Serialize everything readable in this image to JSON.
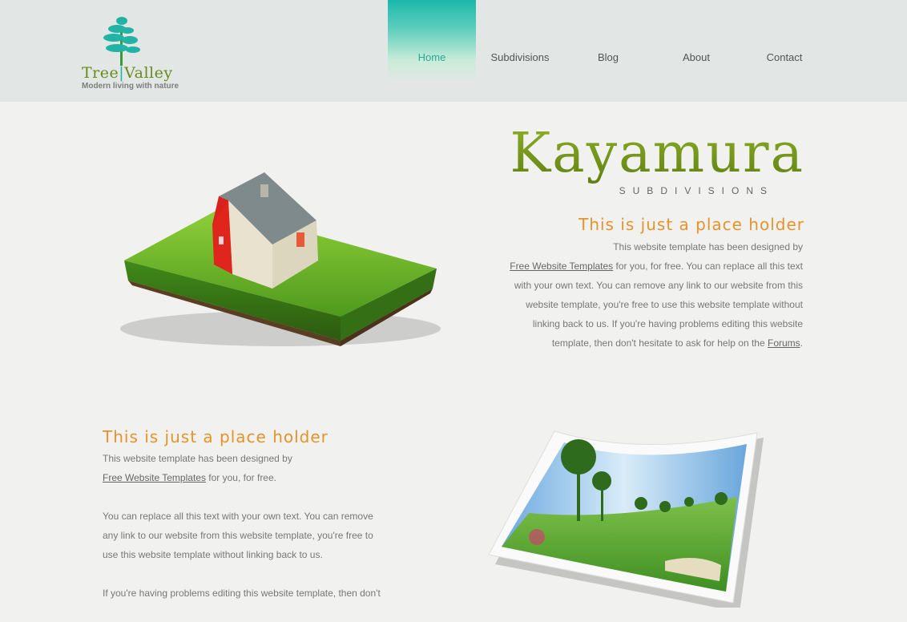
{
  "logo": {
    "name_part1": "Tree",
    "name_part2": "Valley",
    "tagline": "Modern living with nature",
    "icon": "tree-icon"
  },
  "nav": {
    "items": [
      {
        "label": "Home",
        "active": true
      },
      {
        "label": "Subdivisions",
        "active": false
      },
      {
        "label": "Blog",
        "active": false
      },
      {
        "label": "About",
        "active": false
      },
      {
        "label": "Contact",
        "active": false
      }
    ]
  },
  "hero": {
    "brand": "Kayamura",
    "brand_sub": "SUBDIVISIONS",
    "heading": "This is just a place holder",
    "text_1": "This website template has been designed by",
    "link_1": "Free Website Templates",
    "text_2": " for you, for free. You can replace all this text with your own text. You can remove any link to our website from this website template, you're free to use this website template without linking back to us. If you're having problems editing this website template, then don't hesitate to ask for help on the ",
    "link_2": "Forums",
    "text_3": ".",
    "image": "house-on-grass-image"
  },
  "section2": {
    "heading": "This is just a place holder",
    "p1_text": "This website template has been designed by",
    "p1_link": "Free Website Templates",
    "p1_tail": " for you, for free.",
    "p2": "You can replace all this text with your own text. You can remove any link to our website from this website template, you're free to use this website template without linking back to us.",
    "p3": "If you're having problems editing this website template, then don't",
    "image": "golf-course-photo"
  },
  "colors": {
    "accent": "#1bb8aa",
    "brand_green": "#7fa01e",
    "heading_orange": "#e5932c"
  }
}
